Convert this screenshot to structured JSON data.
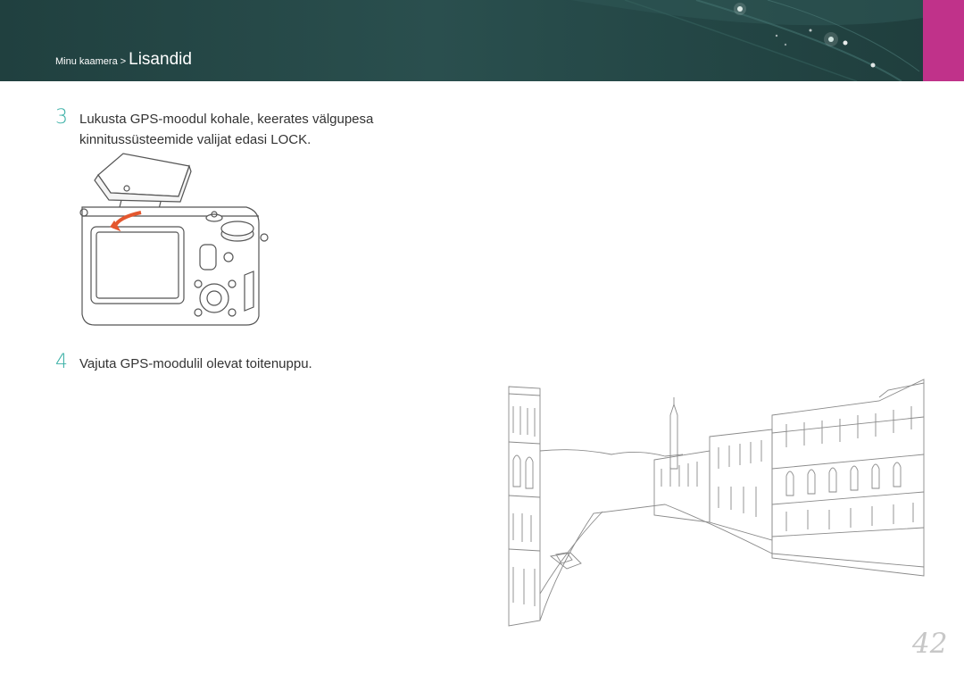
{
  "header": {
    "breadcrumb_parent": "Minu kaamera",
    "breadcrumb_separator": ">",
    "breadcrumb_current": "Lisandid",
    "accent_color": "#c0328a",
    "bar_color": "#244746"
  },
  "steps": [
    {
      "number": "3",
      "lines": [
        "Lukusta GPS-moodul kohale, keerates välgupesa",
        "kinnitussüsteemide valijat edasi LOCK."
      ]
    },
    {
      "number": "4",
      "lines": [
        "Vajuta GPS-moodulil olevat toitenuppu."
      ]
    }
  ],
  "page_number": "42",
  "step_number_color": "#3ab0a6"
}
